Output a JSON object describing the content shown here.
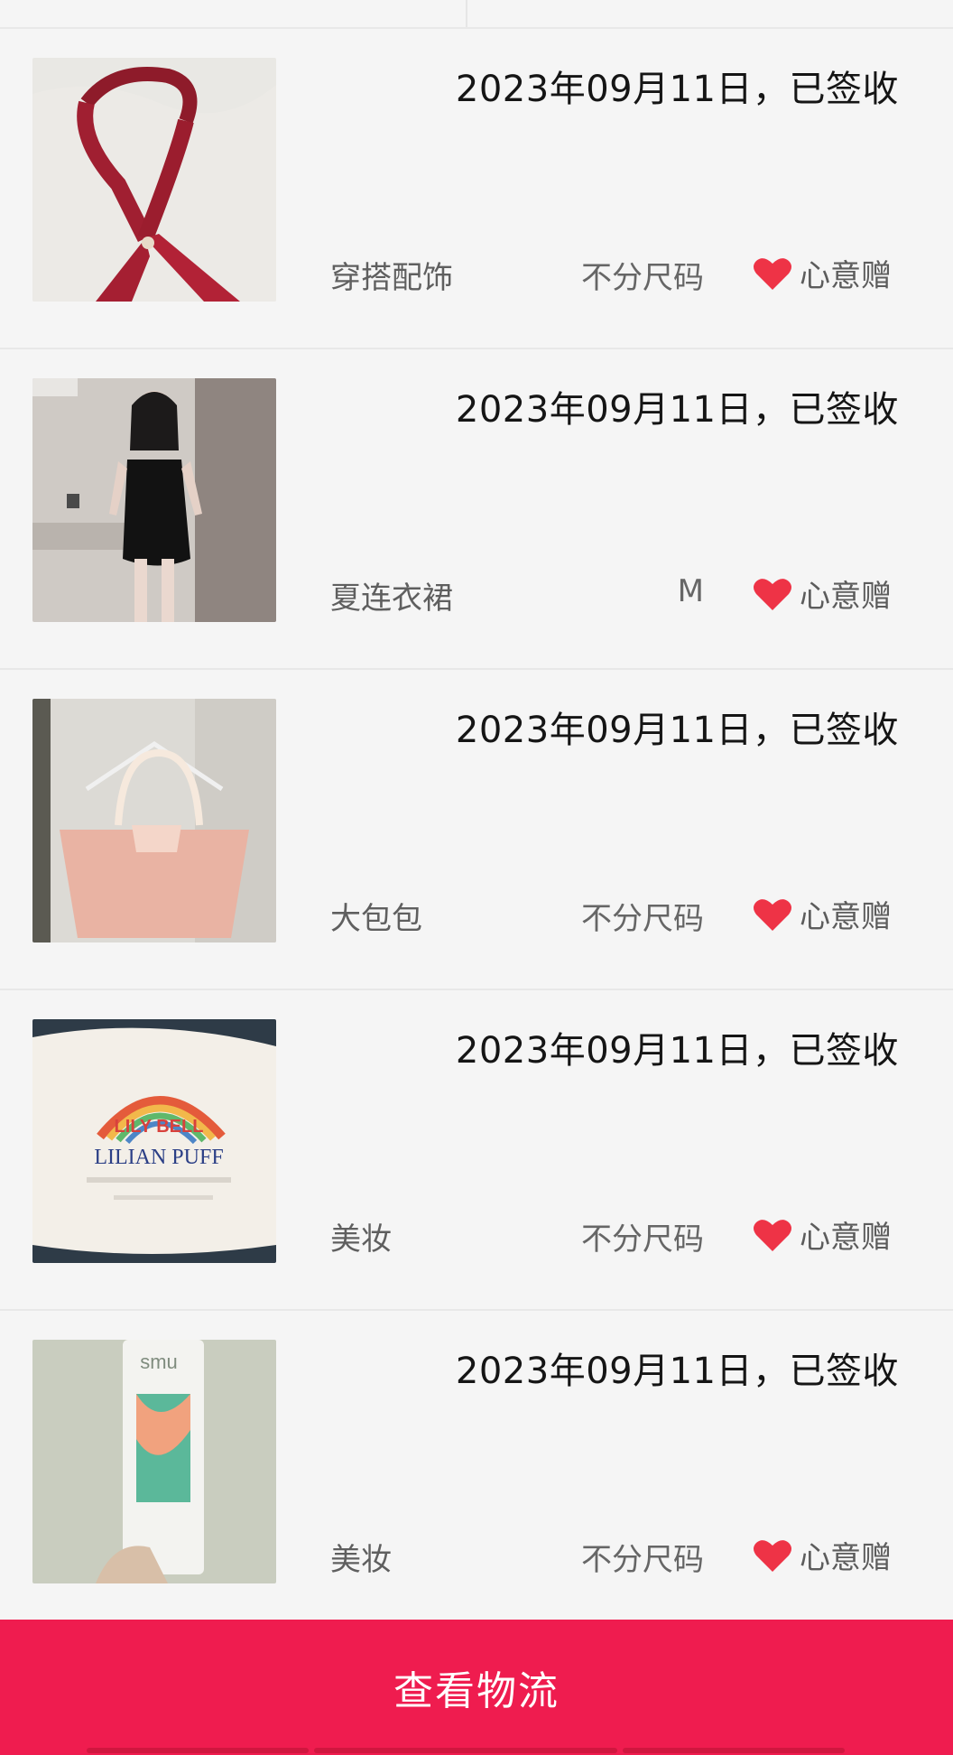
{
  "items": [
    {
      "date": "2023年09月11日，已签收",
      "category": "穿搭配饰",
      "size": "不分尺码",
      "tag": "心意赠",
      "image": "red-bow-tie-image"
    },
    {
      "date": "2023年09月11日，已签收",
      "category": "夏连衣裙",
      "size": "M",
      "tag": "心意赠",
      "image": "black-dress-image"
    },
    {
      "date": "2023年09月11日，已签收",
      "category": "大包包",
      "size": "不分尺码",
      "tag": "心意赠",
      "image": "pink-tote-bag-image"
    },
    {
      "date": "2023年09月11日，已签收",
      "category": "美妆",
      "size": "不分尺码",
      "tag": "心意赠",
      "image": "cotton-pads-bag-image"
    },
    {
      "date": "2023年09月11日，已签收",
      "category": "美妆",
      "size": "不分尺码",
      "tag": "心意赠",
      "image": "skincare-tube-image"
    }
  ],
  "cta": {
    "label": "查看物流"
  },
  "colors": {
    "accent": "#ef1c4f",
    "heart": "#ee3346"
  },
  "logo_texts": [
    "LILY BELL",
    "LILIAN PUFF",
    "smu"
  ]
}
